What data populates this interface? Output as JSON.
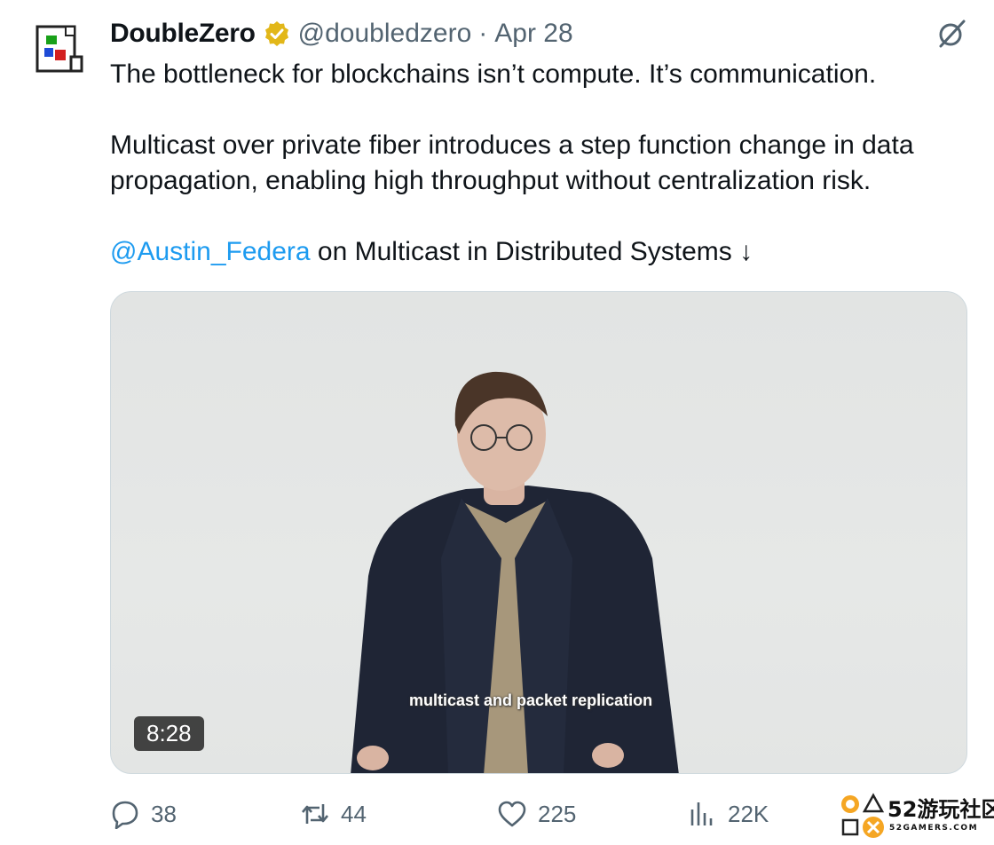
{
  "tweet": {
    "author": "DoubleZero",
    "handle": "@doubledzero",
    "separator": "·",
    "date": "Apr 28",
    "text_line1": "The bottleneck for blockchains isn’t compute. It’s communication.",
    "text_para2": "Multicast over private fiber introduces a step function change in data propagation, enabling high throughput without centralization risk.",
    "mention": "@Austin_Federa",
    "text_para3_rest": " on Multicast in Distributed Systems ↓"
  },
  "video": {
    "subtitle": "multicast and packet replication",
    "duration": "8:28"
  },
  "actions": {
    "replies": "38",
    "reposts": "44",
    "likes": "225",
    "views": "22K"
  },
  "watermark": {
    "big": "52游玩社区",
    "small": "52GAMERS.COM"
  },
  "icons": {
    "verified": "verified-badge-icon",
    "grok": "grok-icon",
    "reply": "reply-icon",
    "repost": "repost-icon",
    "like": "heart-icon",
    "views": "views-chart-icon"
  },
  "colors": {
    "mention": "#1d9bf0",
    "secondary_text": "#536471",
    "verified_gold": "#e2b719"
  }
}
